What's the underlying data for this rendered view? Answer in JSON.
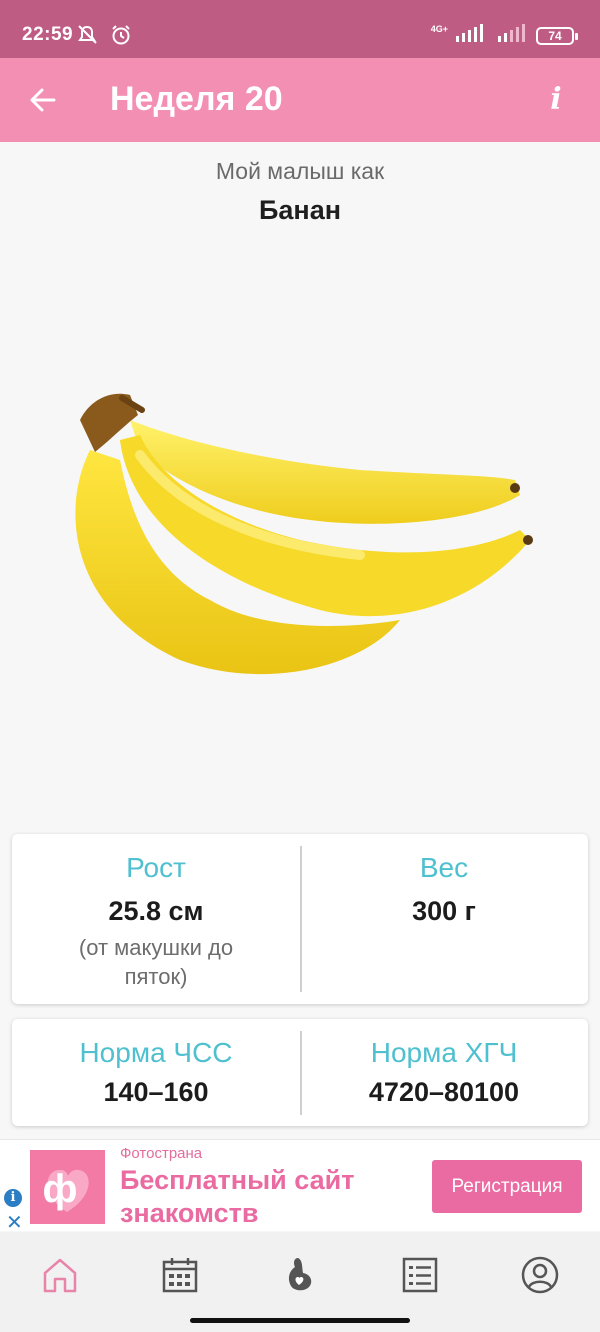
{
  "status_bar": {
    "time": "22:59",
    "network": "4G+",
    "battery": "74"
  },
  "app_bar": {
    "title": "Неделя 20",
    "back_icon": "arrow-left-icon",
    "info_icon": "info-icon"
  },
  "comparison": {
    "subtitle": "Мой малыш как",
    "fruit": "Банан",
    "image": "banana-image"
  },
  "stats": {
    "height": {
      "label": "Рост",
      "value": "25.8 см",
      "note": "(от макушки до пяток)"
    },
    "weight": {
      "label": "Вес",
      "value": "300 г"
    },
    "heart_rate": {
      "label": "Норма ЧСС",
      "value": "140–160"
    },
    "hcg": {
      "label": "Норма ХГЧ",
      "value": "4720–80100"
    }
  },
  "ad": {
    "source": "Фотострана",
    "headline": "Бесплатный сайт знакомств",
    "button": "Регистрация",
    "logo_letter": "ф"
  },
  "bottom_nav": {
    "items": [
      {
        "icon": "home-icon",
        "active": true
      },
      {
        "icon": "calendar-icon",
        "active": false
      },
      {
        "icon": "pregnancy-icon",
        "active": false
      },
      {
        "icon": "checklist-icon",
        "active": false
      },
      {
        "icon": "profile-icon",
        "active": false
      }
    ]
  },
  "colors": {
    "status_bar": "#bf5c84",
    "app_bar": "#f28fb3",
    "stat_label": "#4fc0cf",
    "ad_accent": "#ea6ba1",
    "nav_active": "#e884a9"
  }
}
